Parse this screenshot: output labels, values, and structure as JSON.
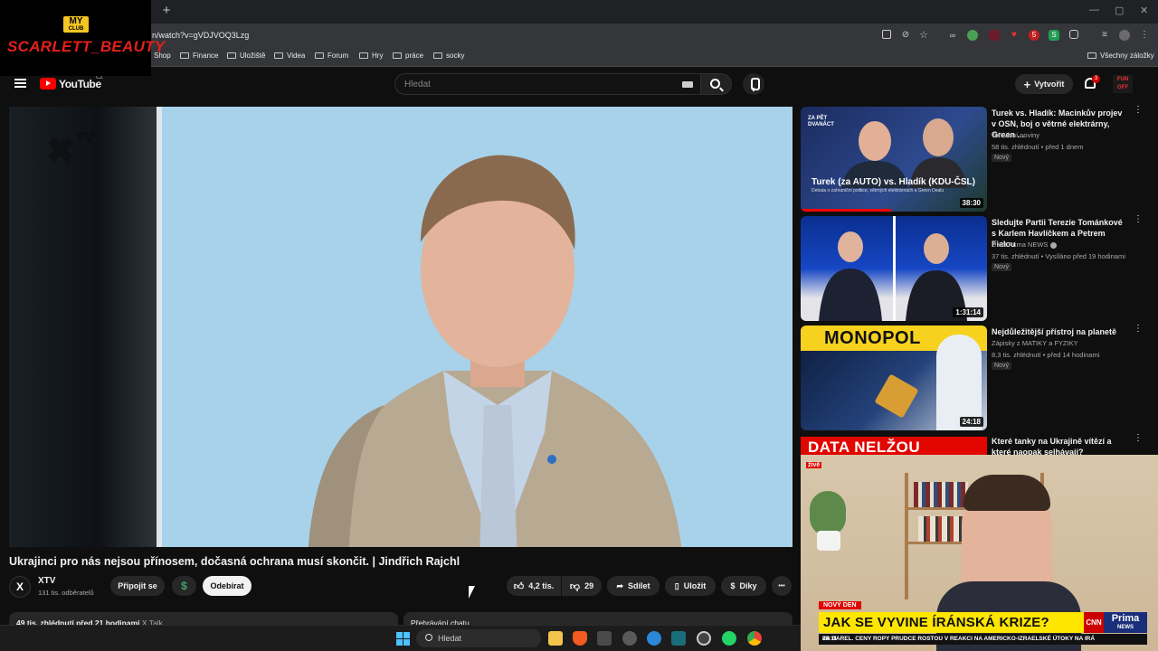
{
  "browser": {
    "url": "n/watch?v=gVDJVOQ3Lzg",
    "newtab": "+",
    "bookmarks": [
      "Shop",
      "Finance",
      "Uložiště",
      "Videa",
      "Forum",
      "Hry",
      "práce",
      "socky"
    ],
    "all_bookmarks": "Všechny záložky",
    "ext_badge_s": "S",
    "ext_badge_5": "5"
  },
  "overlay": {
    "club_top": "MY",
    "club_bottom": "CLUB",
    "name": "SCARLETT_BEAUTY"
  },
  "youtube": {
    "brand": "YouTube",
    "region": "CZ",
    "search_placeholder": "Hledat",
    "create_label": "Vytvořit",
    "notif_count": "3",
    "avatar_text": "FUN OFF"
  },
  "player": {
    "watermark": "TV"
  },
  "video": {
    "title": "Ukrajinci pro nás nejsou přínosem, dočasná ochrana musí skončit. | Jindřich Rajchl",
    "channel_initials": "X",
    "channel": "XTV",
    "subscribers": "131 tis. odběratelů",
    "join_label": "Připojit se",
    "dollar": "$",
    "subscribe_label": "Odebírat",
    "likes": "4,2 tis.",
    "dislikes": "29",
    "share_label": "Sdílet",
    "save_label": "Uložit",
    "thanks_label": "Díky",
    "more": "•••",
    "desc_views": "49 tis. zhlédnutí  před 21 hodinami",
    "desc_tag": "X Talk",
    "chat_label": "Přehrávání chatu"
  },
  "recommendations": [
    {
      "title": "Turek vs. Hladík: Macinkův projev v OSN, boj o větrné elektrárny, Green ...",
      "channel": "Televizní noviny",
      "stats": "58 tis. zhlédnutí • před 1 dnem",
      "badge": "Nový",
      "duration": "38:30",
      "thumb_text": "Turek (za AUTO) vs. Hladík (KDU-ČSL)",
      "thumb_sub": "Debata o zahraniční politice, větrných elektrárnách a Green Dealu",
      "thumb_tag": "ZA PĚT DVANÁCT"
    },
    {
      "title": "Sledujte Partii Terezie Tománkové s Karlem Havlíčkem a Petrem Fialou",
      "channel": "CNN Prima NEWS",
      "stats": "37 tis. zhlédnutí • Vysíláno před 19 hodinami",
      "badge": "Nový",
      "duration": "1:31:14"
    },
    {
      "title": "Nejdůležitější přístroj na planetě",
      "channel": "Zápisky z MATIKY a FYZIKY",
      "stats": "8,3 tis. zhlédnutí • před 14 hodinami",
      "badge": "Nový",
      "duration": "24:18",
      "thumb_text": "MONOPOL"
    },
    {
      "title": "Které tanky na Ukrajině vítězí a které naopak selhávají?",
      "thumb_text": "DATA NELŽOU"
    }
  ],
  "tv": {
    "live": "živě",
    "tag": "NOVÝ DEN",
    "headline": "JAK SE VYVINE ÍRÁNSKÁ KRIZE?",
    "cnn": "CNN",
    "prima": "Prima",
    "prima_sub": "NEWS",
    "ticker": "ZA BAREL.     CENY ROPY PRUDCE ROSTOU V REAKCI NA AMERICKO-IZRAELSKÉ ÚTOKY NA IRÁ",
    "time": "08:11"
  },
  "taskbar": {
    "search_placeholder": "Hledat"
  },
  "colors": {
    "accent": "#ff0000",
    "tv_red": "#e10600",
    "tv_yellow": "#ffe600",
    "windows_blue": "#4cc2ff"
  }
}
